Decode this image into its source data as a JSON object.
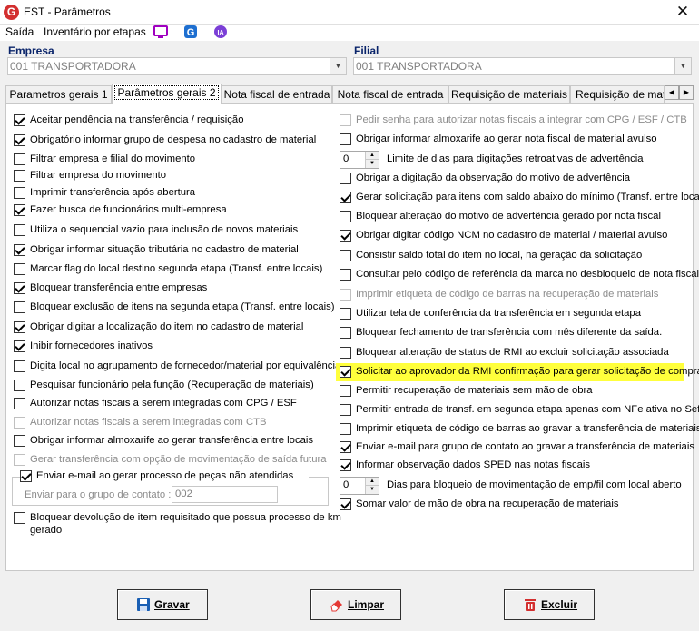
{
  "window": {
    "title": "EST - Parâmetros"
  },
  "menu": {
    "items": [
      "Saída",
      "Inventário por etapas"
    ]
  },
  "company": {
    "label": "Empresa",
    "value": "001 TRANSPORTADORA"
  },
  "branch": {
    "label": "Filial",
    "value": "001 TRANSPORTADORA"
  },
  "tabs": [
    "Parametros gerais 1",
    "Parâmetros gerais 2",
    "Nota fiscal de entrada",
    "Nota fiscal de entrada 2",
    "Requisição de materiais",
    "Requisição de materi"
  ],
  "left_options": [
    {
      "label": "Aceitar pendência na transferência / requisição",
      "checked": true,
      "disabled": false
    },
    {
      "label": "Obrigatório informar grupo de despesa no cadastro de material",
      "checked": true,
      "disabled": false
    },
    {
      "label": "Filtrar empresa e filial do movimento",
      "checked": false,
      "disabled": false
    },
    {
      "label": "Filtrar empresa do movimento",
      "checked": false,
      "disabled": false
    },
    {
      "label": "Imprimir transferência após abertura",
      "checked": false,
      "disabled": false
    },
    {
      "label": "Fazer busca de funcionários multi-empresa",
      "checked": true,
      "disabled": false
    },
    {
      "label": "Utiliza o sequencial vazio para inclusão de novos materiais",
      "checked": false,
      "disabled": false
    },
    {
      "label": "Obrigar informar situação tributária no cadastro de material",
      "checked": true,
      "disabled": false
    },
    {
      "label": "Marcar flag do local destino segunda etapa (Transf. entre locais)",
      "checked": false,
      "disabled": false
    },
    {
      "label": "Bloquear transferência entre empresas",
      "checked": true,
      "disabled": false
    },
    {
      "label": "Bloquear exclusão de itens na segunda etapa (Transf. entre locais)",
      "checked": false,
      "disabled": false
    },
    {
      "label": "Obrigar digitar a localização do item no cadastro de material",
      "checked": true,
      "disabled": false
    },
    {
      "label": "Inibir fornecedores inativos",
      "checked": true,
      "disabled": false
    },
    {
      "label": "Digita local no agrupamento de fornecedor/material por equivalência",
      "checked": false,
      "disabled": false
    },
    {
      "label": "Pesquisar funcionário pela função (Recuperação de materiais)",
      "checked": false,
      "disabled": false
    },
    {
      "label": "Autorizar notas fiscais a serem integradas com CPG / ESF",
      "checked": false,
      "disabled": false
    },
    {
      "label": "Autorizar notas fiscais a serem integradas com CTB",
      "checked": false,
      "disabled": true
    },
    {
      "label": "Obrigar informar almoxarife ao gerar transferência entre locais",
      "checked": false,
      "disabled": false
    },
    {
      "label": "Gerar transferência com opção de movimentação de saída futura",
      "checked": false,
      "disabled": true
    }
  ],
  "email_group": {
    "label": "Enviar e-mail ao gerar processo de peças não atendidas",
    "checked": true,
    "contact_label": "Enviar para o grupo de contato :",
    "contact_value": "002"
  },
  "left_last": {
    "line1": "Bloquear devolução de item requisitado que possua processo de km",
    "line2": "gerado",
    "checked": false
  },
  "right_options": [
    {
      "label": "Pedir senha para autorizar notas fiscais a integrar com CPG / ESF / CTB",
      "checked": false,
      "disabled": true
    },
    {
      "label": "Obrigar informar almoxarife ao gerar nota fiscal de material avulso",
      "checked": false,
      "disabled": false
    },
    {
      "label": "Limite de dias para digitações retroativas de advertência",
      "spinner": "0"
    },
    {
      "label": "Obrigar a digitação da observação do motivo de advertência",
      "checked": false,
      "disabled": false
    },
    {
      "label": "Gerar solicitação para itens com saldo abaixo do mínimo (Transf. entre locais)",
      "checked": true,
      "disabled": false
    },
    {
      "label": "Bloquear alteração do motivo de advertência gerado por nota fiscal",
      "checked": false,
      "disabled": false
    },
    {
      "label": "Obrigar digitar código NCM no cadastro de material / material avulso",
      "checked": true,
      "disabled": false
    },
    {
      "label": "Consistir saldo total do item no local, na geração da solicitação",
      "checked": false,
      "disabled": false
    },
    {
      "label": "Consultar pelo código de referência da marca no desbloqueio de nota fiscal",
      "checked": false,
      "disabled": false
    },
    {
      "label": "Imprimir etiqueta de código de barras na recuperação de materiais",
      "checked": false,
      "disabled": true
    },
    {
      "label": "Utilizar tela de conferência da transferência em segunda etapa",
      "checked": false,
      "disabled": false
    },
    {
      "label": "Bloquear fechamento de transferência com mês diferente da saída.",
      "checked": false,
      "disabled": false
    },
    {
      "label": "Bloquear alteração de status de RMI ao excluir solicitação associada",
      "checked": false,
      "disabled": false
    },
    {
      "label": "Solicitar ao aprovador da RMI confirmação para gerar solicitação de compra",
      "checked": true,
      "disabled": false,
      "highlight": true
    },
    {
      "label": "Permitir recuperação de materiais sem mão de obra",
      "checked": false,
      "disabled": false
    },
    {
      "label": "Permitir entrada de transf. em segunda etapa apenas com NFe ativa no Sefaz",
      "checked": false,
      "disabled": false
    },
    {
      "label": "Imprimir etiqueta de código de barras ao gravar a transferência de materiais",
      "checked": false,
      "disabled": false
    },
    {
      "label": "Enviar e-mail para grupo de contato ao gravar a transferência de materiais",
      "checked": true,
      "disabled": false
    },
    {
      "label": "Informar observação dados SPED nas notas fiscais",
      "checked": true,
      "disabled": false
    },
    {
      "label": "Dias para bloqueio de movimentação de emp/fil com local aberto",
      "spinner": "0"
    },
    {
      "label": "Somar valor de mão de obra na recuperação de materiais",
      "checked": true,
      "disabled": false
    }
  ],
  "buttons": {
    "save": "Gravar",
    "clear": "Limpar",
    "delete": "Excluir"
  },
  "colors": {
    "highlight": "#ffff3c",
    "label_blue": "#0a246a",
    "app_red": "#d32f2f"
  }
}
